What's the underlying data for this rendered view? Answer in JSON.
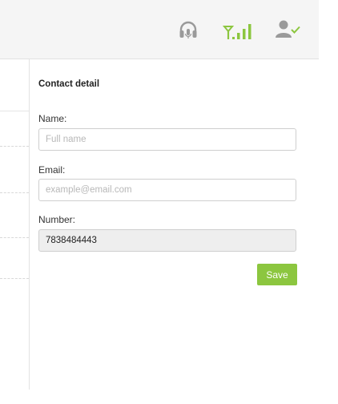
{
  "topbar": {
    "icons": [
      "headset-icon",
      "network-signal-icon",
      "agent-available-icon"
    ],
    "accent_color": "#8cc63f",
    "icon_gray": "#9a9a9a"
  },
  "contact_panel": {
    "title": "Contact detail",
    "name": {
      "label": "Name:",
      "placeholder": "Full name",
      "value": ""
    },
    "email": {
      "label": "Email:",
      "placeholder": "example@email.com",
      "value": ""
    },
    "number": {
      "label": "Number:",
      "value": "7838484443"
    },
    "save_label": "Save"
  }
}
